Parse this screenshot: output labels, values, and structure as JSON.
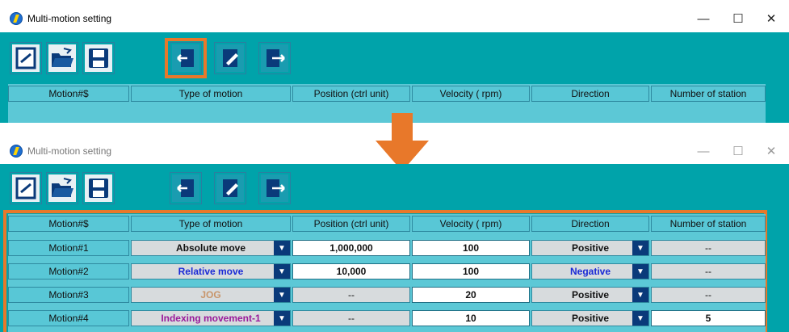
{
  "window": {
    "title": "Multi-motion setting",
    "minimize": "—",
    "maximize": "☐",
    "close": "✕"
  },
  "toolbar": {
    "buttons": [
      "new-icon",
      "open-folder-icon",
      "save-icon",
      "import-icon",
      "edit-icon",
      "export-icon"
    ]
  },
  "table": {
    "headers": [
      "Motion#$",
      "Type of motion",
      "Position (ctrl unit)",
      "Velocity ( rpm)",
      "Direction",
      "Number of station"
    ],
    "rows": [
      {
        "motion": "Motion#1",
        "type": "Absolute move",
        "type_color": "#000000",
        "position": "1,000,000",
        "velocity": "100",
        "direction": "Positive",
        "direction_color": "#000000",
        "stations": "--"
      },
      {
        "motion": "Motion#2",
        "type": "Relative move",
        "type_color": "#1a2ad6",
        "position": "10,000",
        "velocity": "100",
        "direction": "Negative",
        "direction_color": "#1a2ad6",
        "stations": "--"
      },
      {
        "motion": "Motion#3",
        "type": "JOG",
        "type_color": "#c8956a",
        "position": "--",
        "velocity": "20",
        "direction": "Positive",
        "direction_color": "#000000",
        "stations": "--"
      },
      {
        "motion": "Motion#4",
        "type": "Indexing movement-1",
        "type_color": "#9a1a9a",
        "position": "--",
        "velocity": "10",
        "direction": "Positive",
        "direction_color": "#000000",
        "stations": "5"
      }
    ]
  },
  "colors": {
    "panel": "#00a3aa",
    "highlight": "#e8782a",
    "dropdown_arrow": "#0a3a7a"
  }
}
